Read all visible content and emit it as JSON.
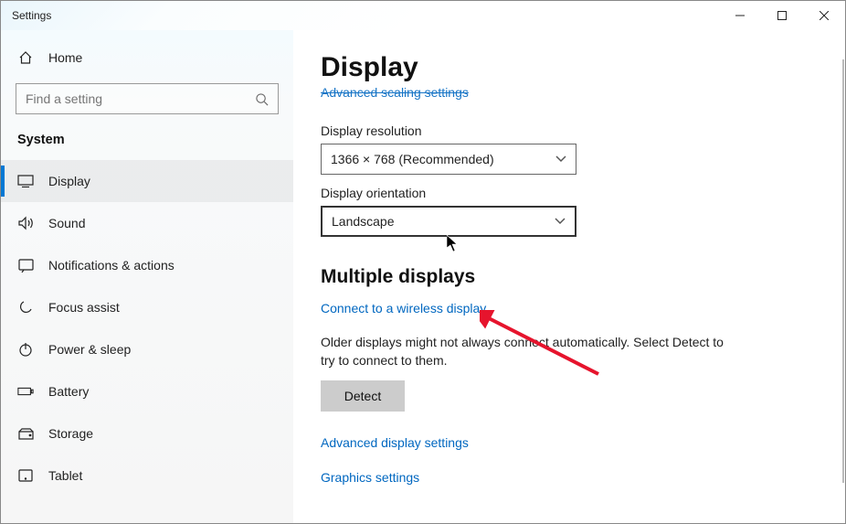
{
  "window": {
    "title": "Settings"
  },
  "sidebar": {
    "home": "Home",
    "search_placeholder": "Find a setting",
    "category": "System",
    "items": [
      {
        "label": "Display"
      },
      {
        "label": "Sound"
      },
      {
        "label": "Notifications & actions"
      },
      {
        "label": "Focus assist"
      },
      {
        "label": "Power & sleep"
      },
      {
        "label": "Battery"
      },
      {
        "label": "Storage"
      },
      {
        "label": "Tablet"
      }
    ]
  },
  "main": {
    "title": "Display",
    "cut_link": "Advanced scaling settings",
    "resolution": {
      "label": "Display resolution",
      "value": "1366 × 768 (Recommended)"
    },
    "orientation": {
      "label": "Display orientation",
      "value": "Landscape"
    },
    "multi_heading": "Multiple displays",
    "connect_link": "Connect to a wireless display",
    "detect_text": "Older displays might not always connect automatically. Select Detect to try to connect to them.",
    "detect_btn": "Detect",
    "adv_link": "Advanced display settings",
    "gfx_link": "Graphics settings"
  }
}
